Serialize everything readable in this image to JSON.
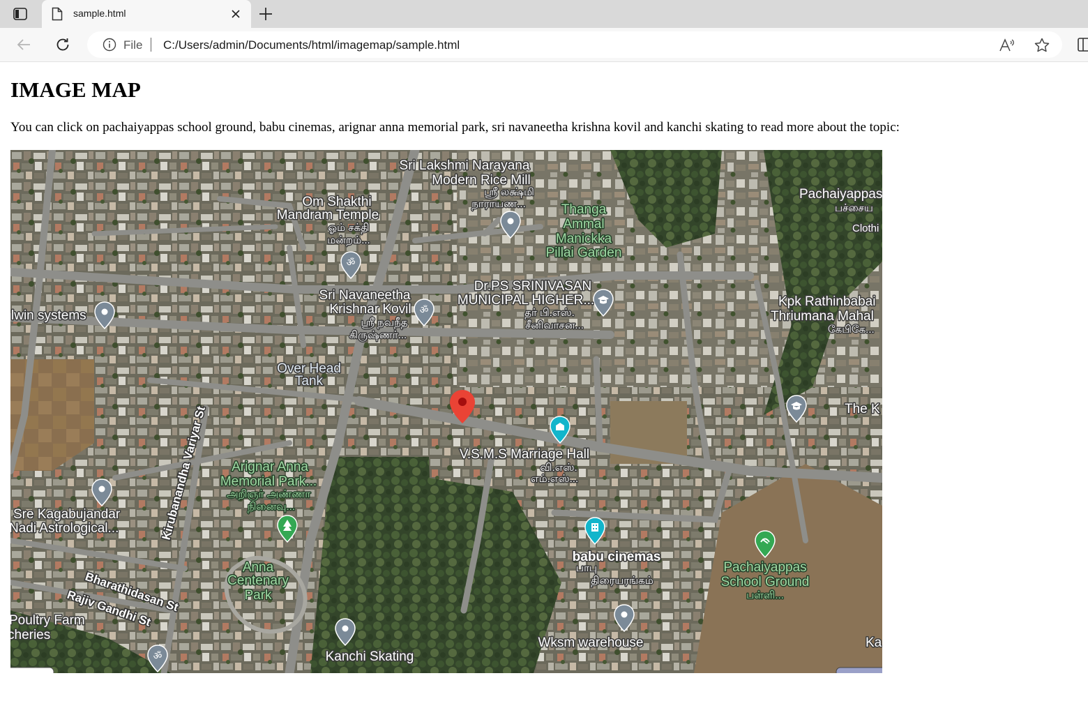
{
  "browser": {
    "tab_title": "sample.html",
    "file_label": "File",
    "url": "C:/Users/admin/Documents/html/imagemap/sample.html"
  },
  "page": {
    "heading": "IMAGE MAP",
    "intro": "You can click on pachaiyappas school ground, babu cinemas, arignar anna memorial park, sri navaneetha krishna kovil and kanchi skating to read more about the topic:"
  },
  "map": {
    "labels": {
      "lakshmi_mill_1": "Sri Lakshmi Narayana",
      "lakshmi_mill_2": "Modern Rice Mill",
      "lakshmi_mill_ta1": "ஸ்ரீ லக்ஷ்மி",
      "lakshmi_mill_ta2": "நாராயண...",
      "om_shakthi_1": "Om Shakthi",
      "om_shakthi_2": "Mandram Temple",
      "om_shakthi_ta1": "ஓம் சக்தி",
      "om_shakthi_ta2": "மன்றம்...",
      "thanga_1": "Thanga",
      "thanga_2": "Ammal",
      "thanga_3": "Manickka",
      "thanga_4": "Pillai Garden",
      "pachaiyappas_top_1": "Pachaiyappas",
      "pachaiyappas_top_ta": "பச்சைய",
      "pachaiyappas_top_3": "Clothi",
      "navaneetha_1": "Sri Navaneetha",
      "navaneetha_2": "Krishnar Kovil",
      "navaneetha_ta1": "ஸ்ரீ நவநீத",
      "navaneetha_ta2": "கிருஷ்ணர்...",
      "drps_1": "Dr.PS SRINIVASAN",
      "drps_2": "MUNICIPAL HIGHER...",
      "drps_ta1": "தர் பி.எஸ்.",
      "drps_ta2": "சீனிவாசன...",
      "kpk_1": "Kpk Rathinbabai",
      "kpk_2": "Thriumana Mahal",
      "kpk_ta": "கேபிகே...",
      "lwin": "lwin systems",
      "overhead_1": "Over Head",
      "overhead_2": "Tank",
      "the_k": "The K",
      "vsms": "V.S.M.S Marriage Hall",
      "vsms_ta1": "வி.எஸ்.",
      "vsms_ta2": "எம்.எஸ்...",
      "arignar_1": "Arignar Anna",
      "arignar_2": "Memorial Park...",
      "arignar_ta1": "அறிஞர் அண்ணா",
      "arignar_ta2": "நினைவு...",
      "kirubanandha": "Kirubanandha Variyar St",
      "sre_1": "Sre Kagabujandar",
      "sre_2": "Nadi Astrological...",
      "babu": "babu cinemas",
      "babu_ta1": "பாபு",
      "babu_ta2": "திரையரங்கம்",
      "pach_ground_1": "Pachaiyappas",
      "pach_ground_2": "School Ground",
      "pach_ground_ta": "பள்ளி...",
      "anna_1": "Anna",
      "anna_2": "Centenary",
      "anna_3": "Park",
      "bharathidasan": "Bharathidasan St",
      "rajiv": "Rajiv Gandhi St",
      "poultry_1": "Poultry Farm",
      "poultry_2": "cheries",
      "kanchi": "Kanchi Skating",
      "wksm": "Wksm warehouse",
      "ka": "Ka"
    },
    "colors": {
      "pin_gray": "#7b8a98",
      "pin_red": "#ea4335",
      "pin_teal": "#12b5cb",
      "pin_green": "#34a853",
      "road": "#8e8e8a"
    }
  }
}
